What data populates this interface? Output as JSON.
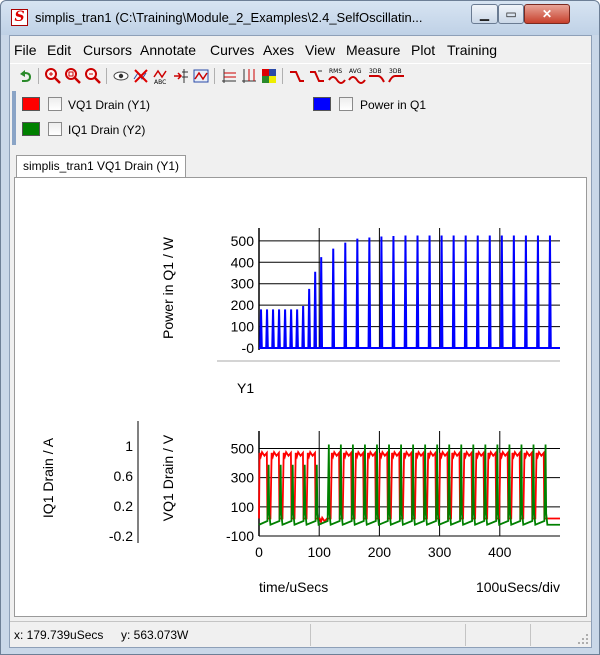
{
  "window": {
    "title": "simplis_tran1 (C:\\Training\\Module_2_Examples\\2.4_SelfOscillatin...",
    "minimize": "▁",
    "maximize": "▭",
    "close": "✕"
  },
  "menu": {
    "items": [
      "File",
      "Edit",
      "Cursors",
      "Annotate",
      "Curves",
      "Axes",
      "View",
      "Measure",
      "Plot",
      "Training"
    ]
  },
  "toolbar": {
    "icons": [
      "undo-icon",
      "zoom-in-icon",
      "zoom-fit-icon",
      "zoom-out-icon",
      "view-eye-icon",
      "delete-curve-icon",
      "rename-curve-icon",
      "add-axis-icon",
      "curve-props-icon",
      "grid-h-icon",
      "grid-v-icon",
      "color-icon",
      "rise-time-icon",
      "fall-time-icon",
      "rms-icon",
      "avg-icon",
      "3db-low-icon",
      "3db-high-icon"
    ],
    "rms_label": "RMS",
    "avg_label": "AVG",
    "db_label": "3DB"
  },
  "legend": {
    "items": [
      {
        "label": "VQ1 Drain (Y1)",
        "color": "#ff0000"
      },
      {
        "label": "IQ1 Drain (Y2)",
        "color": "#008000"
      },
      {
        "label": "Power in Q1",
        "color": "#0000ff"
      }
    ]
  },
  "tab": {
    "label": "simplis_tran1 VQ1 Drain (Y1)"
  },
  "plot": {
    "top": {
      "ylabel": "Power in Q1 / W",
      "yticks": [
        "500",
        "400",
        "300",
        "200",
        "100",
        "-0"
      ]
    },
    "bottom": {
      "group_label": "Y1",
      "y1label": "VQ1 Drain / V",
      "y1ticks": [
        "500",
        "300",
        "100",
        "-100"
      ],
      "y2label": "IQ1 Drain / A",
      "y2ticks": [
        "1",
        "0.6",
        "0.2",
        "-0.2"
      ],
      "xticks": [
        "0",
        "100",
        "200",
        "300",
        "400"
      ],
      "xlabel": "time/uSecs",
      "xdiv": "100uSecs/div"
    }
  },
  "chart_data": [
    {
      "type": "line",
      "series": [
        {
          "name": "Power in Q1",
          "color": "#0000ff",
          "x": [
            0,
            10,
            40,
            70,
            100,
            130,
            160,
            200,
            240,
            280,
            330,
            370,
            410,
            450,
            480
          ],
          "values": [
            180,
            180,
            180,
            180,
            420,
            480,
            510,
            520,
            525,
            525,
            525,
            525,
            525,
            525,
            525
          ]
        }
      ],
      "xlim": [
        0,
        500
      ],
      "ylim": [
        -10,
        560
      ],
      "ylabel": "Power in Q1 / W",
      "grid": true
    },
    {
      "type": "line",
      "series": [
        {
          "name": "VQ1 Drain",
          "color": "#ff0000",
          "x": [
            0,
            10,
            20,
            100,
            110,
            120,
            200,
            300,
            400,
            480
          ],
          "values": [
            20,
            470,
            470,
            470,
            20,
            470,
            470,
            470,
            470,
            470
          ]
        },
        {
          "name": "IQ1 Drain",
          "color": "#008000",
          "x": [
            0,
            10,
            100,
            110,
            200,
            300,
            400,
            480
          ],
          "values": [
            -0.05,
            0.75,
            0.75,
            1.02,
            1.02,
            1.02,
            1.02,
            1.02
          ]
        }
      ],
      "xlim": [
        0,
        500
      ],
      "ylim": [
        -100,
        620
      ],
      "y2lim": [
        -0.2,
        1.2
      ],
      "xlabel": "time/uSecs",
      "ylabel": "VQ1 Drain / V",
      "y2label": "IQ1 Drain / A",
      "grid": true
    }
  ],
  "status": {
    "x": "x: 179.739uSecs",
    "y": "y: 563.073W"
  }
}
